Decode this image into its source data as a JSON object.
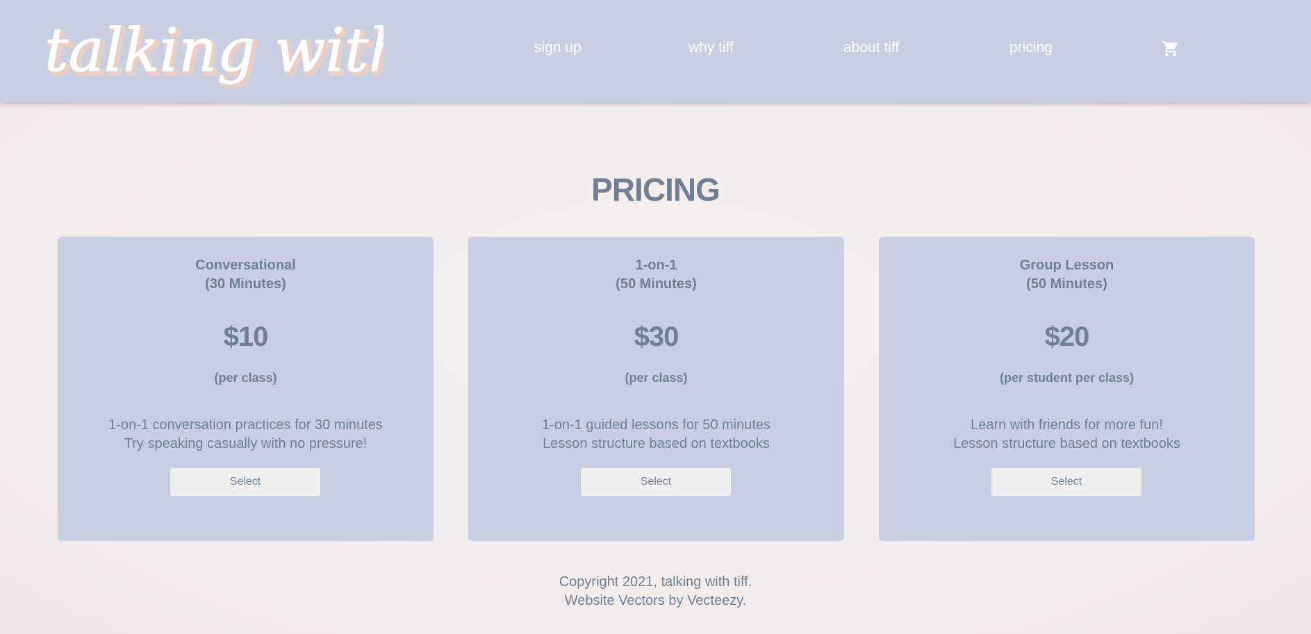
{
  "header": {
    "logo_text": "talking with tiff",
    "nav": [
      {
        "label": "sign up"
      },
      {
        "label": "why tiff"
      },
      {
        "label": "about tiff"
      },
      {
        "label": "pricing"
      }
    ],
    "cart_icon": "shopping-cart-icon"
  },
  "main": {
    "title": "PRICING",
    "cards": [
      {
        "name": "Conversational",
        "duration": "(30 Minutes)",
        "price": "$10",
        "unit": "(per class)",
        "desc_line1": "1-on-1 conversation practices for 30 minutes",
        "desc_line2": "Try speaking casually with no pressure!",
        "button_label": "Select"
      },
      {
        "name": "1-on-1",
        "duration": "(50 Minutes)",
        "price": "$30",
        "unit": "(per class)",
        "desc_line1": "1-on-1 guided lessons for 50 minutes",
        "desc_line2": "Lesson structure based on textbooks",
        "button_label": "Select"
      },
      {
        "name": "Group Lesson",
        "duration": "(50 Minutes)",
        "price": "$20",
        "unit": "(per student per class)",
        "desc_line1": "Learn with friends for more fun!",
        "desc_line2": "Lesson structure based on textbooks",
        "button_label": "Select"
      }
    ]
  },
  "footer": {
    "copyright": "Copyright 2021, talking with tiff.",
    "credits": "Website Vectors by Vecteezy."
  },
  "colors": {
    "header_bg": "#c9cfe1",
    "page_bg": "#f4eeee",
    "text": "#717f93",
    "button_bg": "#f0f0f0",
    "logo_shadow": "#e8cfc6"
  }
}
